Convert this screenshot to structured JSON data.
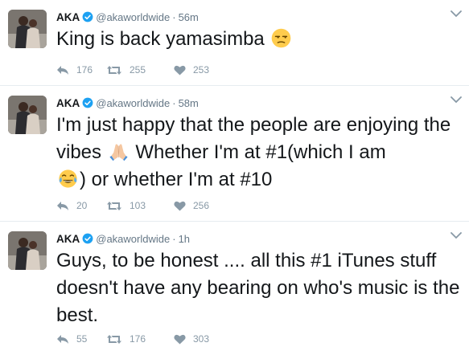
{
  "colors": {
    "verified": "#1da1f2",
    "muted": "#657786",
    "action": "#8899a6",
    "divider": "#e6ecf0"
  },
  "tweets": [
    {
      "name": "AKA",
      "handle": "@akaworldwide",
      "separator": "·",
      "time": "56m",
      "text_parts": [
        "King is back yamasimba"
      ],
      "emojis": [
        "unamused-face-emoji"
      ],
      "replies": "176",
      "retweets": "255",
      "likes": "253"
    },
    {
      "name": "AKA",
      "handle": "@akaworldwide",
      "separator": "·",
      "time": "58m",
      "text_parts": [
        "I'm just happy that the people are enjoying the vibes",
        "Whether I'm at #1(which I am",
        ") or whether I'm at #10"
      ],
      "emojis": [
        "folded-hands-emoji",
        "tears-of-joy-emoji"
      ],
      "replies": "20",
      "retweets": "103",
      "likes": "256"
    },
    {
      "name": "AKA",
      "handle": "@akaworldwide",
      "separator": "·",
      "time": "1h",
      "text_parts": [
        "Guys, to be honest .... all this #1 iTunes stuff doesn't have any bearing on who's music is the best."
      ],
      "emojis": [],
      "replies": "55",
      "retweets": "176",
      "likes": "303"
    }
  ]
}
